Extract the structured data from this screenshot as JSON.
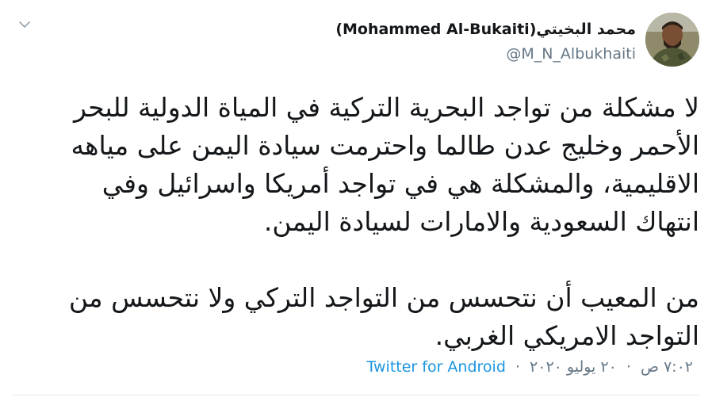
{
  "header": {
    "display_name": "محمد البخيتي(Mohammed Al-Bukaiti)",
    "handle": "@M_N_Albukhaiti",
    "avatar_icon": "profile-photo",
    "menu_icon": "chevron-down-icon"
  },
  "tweet": {
    "paragraphs": [
      "لا مشكلة من تواجد البحرية التركية في المياة الدولية للبحر الأحمر وخليج عدن طالما واحترمت سيادة اليمن على مياهه الاقليمية، والمشكلة هي في تواجد أمريكا واسرائيل وفي انتهاك السعودية والامارات لسيادة اليمن.",
      "من المعيب أن نتحسس من التواجد التركي ولا نتحسس من التواجد الامريكي الغربي."
    ]
  },
  "meta": {
    "time": "٧:٠٢ ص",
    "date": "٢٠ يوليو ٢٠٢٠",
    "separator": "·",
    "source": "Twitter for Android"
  },
  "colors": {
    "text": "#14171a",
    "muted": "#657786",
    "link": "#1b95e0",
    "divider": "#e6ecf0"
  }
}
